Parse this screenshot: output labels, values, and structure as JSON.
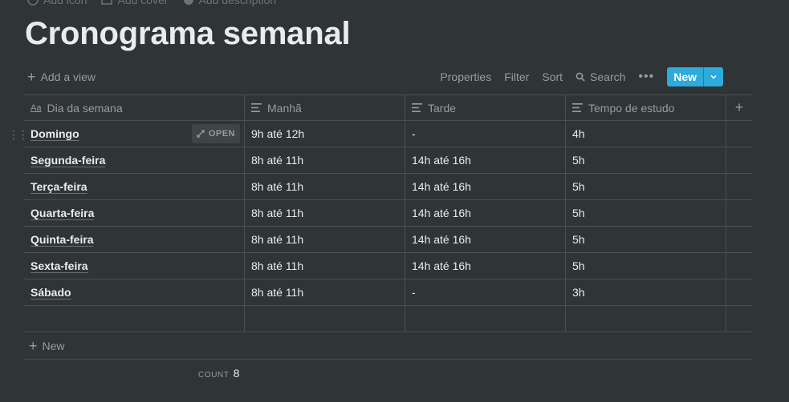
{
  "page": {
    "meta": {
      "add_icon": "Add icon",
      "add_cover": "Add cover",
      "add_description": "Add description"
    },
    "title": "Cronograma semanal"
  },
  "toolbar": {
    "add_view": "Add a view",
    "properties": "Properties",
    "filter": "Filter",
    "sort": "Sort",
    "search": "Search",
    "more": "•••",
    "new": "New",
    "accent": "#2eaadc"
  },
  "table": {
    "columns": [
      "Dia da semana",
      "Manhã",
      "Tarde",
      "Tempo de estudo"
    ],
    "open_label": "OPEN",
    "rows": [
      {
        "dia": "Domingo",
        "manha": "9h até 12h",
        "tarde": "-",
        "tempo": "4h"
      },
      {
        "dia": "Segunda-feira",
        "manha": "8h até 11h",
        "tarde": "14h até 16h",
        "tempo": "5h"
      },
      {
        "dia": "Terça-feira",
        "manha": "8h até 11h",
        "tarde": "14h até 16h",
        "tempo": "5h"
      },
      {
        "dia": "Quarta-feira",
        "manha": "8h até 11h",
        "tarde": "14h até 16h",
        "tempo": "5h"
      },
      {
        "dia": "Quinta-feira",
        "manha": "8h até 11h",
        "tarde": "14h até 16h",
        "tempo": "5h"
      },
      {
        "dia": "Sexta-feira",
        "manha": "8h até 11h",
        "tarde": "14h até 16h",
        "tempo": "5h"
      },
      {
        "dia": "Sábado",
        "manha": "8h até 11h",
        "tarde": "-",
        "tempo": "3h"
      }
    ],
    "new_row": "New",
    "count_label": "COUNT",
    "count_value": "8"
  }
}
